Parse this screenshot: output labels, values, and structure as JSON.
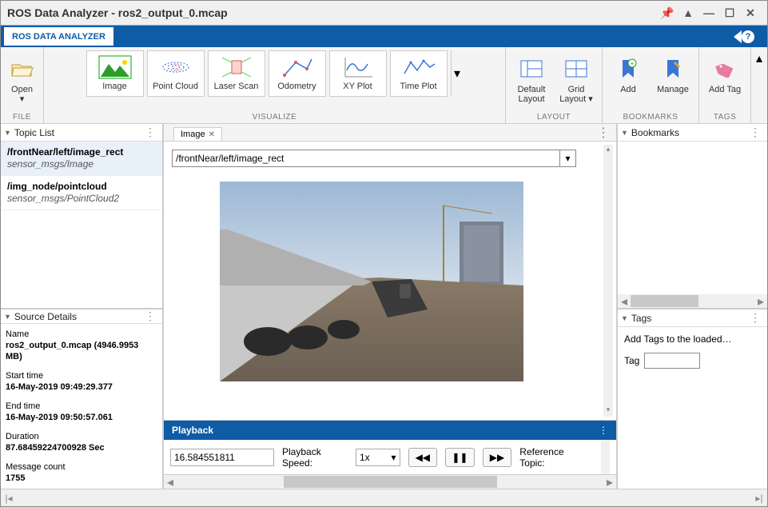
{
  "window": {
    "title": "ROS Data Analyzer - ros2_output_0.mcap"
  },
  "bluetab": "ROS DATA ANALYZER",
  "ribbon": {
    "file": {
      "open": "Open",
      "caption": "FILE"
    },
    "visualize": {
      "caption": "VISUALIZE",
      "items": [
        {
          "label": "Image"
        },
        {
          "label": "Point Cloud"
        },
        {
          "label": "Laser Scan"
        },
        {
          "label": "Odometry"
        },
        {
          "label": "XY Plot"
        },
        {
          "label": "Time Plot"
        }
      ]
    },
    "layout": {
      "caption": "LAYOUT",
      "default": "Default\nLayout",
      "grid": "Grid\nLayout"
    },
    "bookmarks": {
      "caption": "BOOKMARKS",
      "add": "Add",
      "manage": "Manage"
    },
    "tags": {
      "caption": "TAGS",
      "addtag": "Add Tag"
    }
  },
  "topicList": {
    "title": "Topic List",
    "items": [
      {
        "name": "/frontNear/left/image_rect",
        "type": "sensor_msgs/Image"
      },
      {
        "name": "/img_node/pointcloud",
        "type": "sensor_msgs/PointCloud2"
      }
    ]
  },
  "sourceDetails": {
    "title": "Source Details",
    "rows": [
      {
        "l": "Name",
        "v": "ros2_output_0.mcap (4946.9953 MB)"
      },
      {
        "l": "Start time",
        "v": "16-May-2019 09:49:29.377"
      },
      {
        "l": "End time",
        "v": "16-May-2019 09:50:57.061"
      },
      {
        "l": "Duration",
        "v": "87.68459224700928 Sec"
      },
      {
        "l": "Message count",
        "v": "1755"
      }
    ]
  },
  "center": {
    "tab": "Image",
    "dropdown": "/frontNear/left/image_rect",
    "playback": {
      "title": "Playback",
      "time": "16.584551811",
      "speedLabel": "Playback Speed:",
      "speed": "1x",
      "refLabel": "Reference Topic:"
    }
  },
  "right": {
    "bookmarks": {
      "title": "Bookmarks"
    },
    "tags": {
      "title": "Tags",
      "hint": "Add Tags to the loaded…",
      "tagLabel": "Tag"
    }
  }
}
